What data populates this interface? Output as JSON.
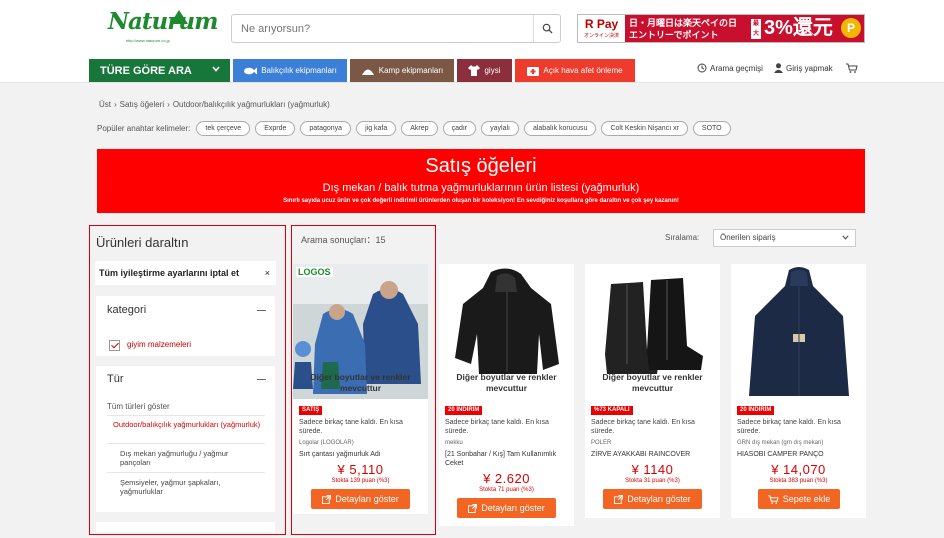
{
  "header": {
    "logo_text": "Naturum",
    "logo_sub": "http://www.naturum.co.jp",
    "search_placeholder": "Ne arıyorsun?",
    "banner": {
      "rpay": "R Pay",
      "rpay_sub": "オンライン決済",
      "line1": "日・月曜日は楽天ペイの日",
      "line2": "エントリーでポイント",
      "max": "最大",
      "big": "3%還元",
      "coin": "P"
    }
  },
  "nav": {
    "category_btn": "TÜRE GÖRE ARA",
    "items": [
      {
        "label": "Balıkçılık ekipmanları",
        "icon": "fish-icon",
        "color": "#3b7fd9"
      },
      {
        "label": "Kamp ekipmanları",
        "icon": "tent-icon",
        "color": "#7a5845"
      },
      {
        "label": "giysi",
        "icon": "shirt-icon",
        "color": "#8b2f3c"
      },
      {
        "label": "Açık hava afet önleme",
        "icon": "first-aid-icon",
        "color": "#ee3b2b"
      }
    ],
    "history": "Arama geçmişi",
    "login": "Giriş yapmak"
  },
  "breadcrumb": [
    "Üst",
    "Satış öğeleri",
    "Outdoor/balıkçılık yağmurlukları (yağmurluk)"
  ],
  "keywords": {
    "label": "Popüler anahtar kelimeler:",
    "tags": [
      "tek çerçeve",
      "Exprde",
      "patagonya",
      "jig kafa",
      "Akrep",
      "çadır",
      "yaylalı",
      "alabalık korucusu",
      "Colt Keskin Nişancı xr",
      "SOTO"
    ]
  },
  "sale_banner": {
    "title": "Satış öğeleri",
    "subtitle": "Dış mekan / balık tutma yağmurluklarının ürün listesi (yağmurluk)",
    "note": "Sınırlı sayıda ucuz ürün ve çok değerli indirimli ürünlerden oluşan bir koleksiyon! En sevdiğiniz koşullara göre daraltın ve çok şey kazanın!"
  },
  "sidebar": {
    "title": "Ürünleri daraltın",
    "reset": "Tüm iyileştirme ayarlarını iptal et",
    "category_title": "kategori",
    "category_checked": "giyim malzemeleri",
    "type_title": "Tür",
    "type_all": "Tüm türleri göster",
    "type_selected": "Outdoor/balıkçılık yağmurlukları (yağmurluk)",
    "type_items": [
      "Dış mekan yağmurluğu / yağmur pançoları",
      "Şemsiyeler, yağmur şapkaları, yağmurluklar"
    ]
  },
  "results": {
    "count_label": "Arama sonuçları：15",
    "sort_label": "Sıralama:",
    "sort_value": "Önerilen sipariş"
  },
  "products": [
    {
      "avail": "Diğer boyutlar ve renkler mevcuttur",
      "badge": "SATIŞ",
      "stock": "Sadece birkaç tane kaldı.  En kısa sürede.",
      "brand": "Logolar (LOGOLAR)",
      "name": "Sırt çantası yağmurluk Adı",
      "price": "¥ 5,110",
      "points": "Stokta 139 puan (%3)",
      "button": "Detayları göster",
      "img_logo": "LOGOS"
    },
    {
      "avail": "Diğer boyutlar ve renkler mevcuttur",
      "badge": "20 İNDİRİM",
      "stock": "Sadece birkaç tane kaldı.  En kısa sürede.",
      "brand": "mekku",
      "name": "[21 Sonbahar / Kış] Tam Kullanımlık Ceket",
      "price": "¥ 2.620",
      "points": "Stokta 71 puan (%3)",
      "button": "Detayları göster"
    },
    {
      "avail": "Diğer boyutlar ve renkler mevcuttur",
      "badge": "%73 KAPALI",
      "stock": "Sadece birkaç tane kaldı.  En kısa sürede.",
      "brand": "POLER",
      "name": "ZİRVE AYAKKABI RAINCOVER",
      "price": "¥ 1140",
      "points": "Stokta 31 puan (%3)",
      "button": "Detayları göster"
    },
    {
      "avail": "",
      "badge": "20 İNDİRİM",
      "stock": "Sadece birkaç tane kaldı.  En kısa sürede.",
      "brand": "GRN dış mekan (grn dış mekan)",
      "name": "HIASOBI CAMPER PANÇO",
      "price": "¥ 14,070",
      "points": "Stokta 383 puan (%3)",
      "button": "Sepete ekle"
    }
  ]
}
